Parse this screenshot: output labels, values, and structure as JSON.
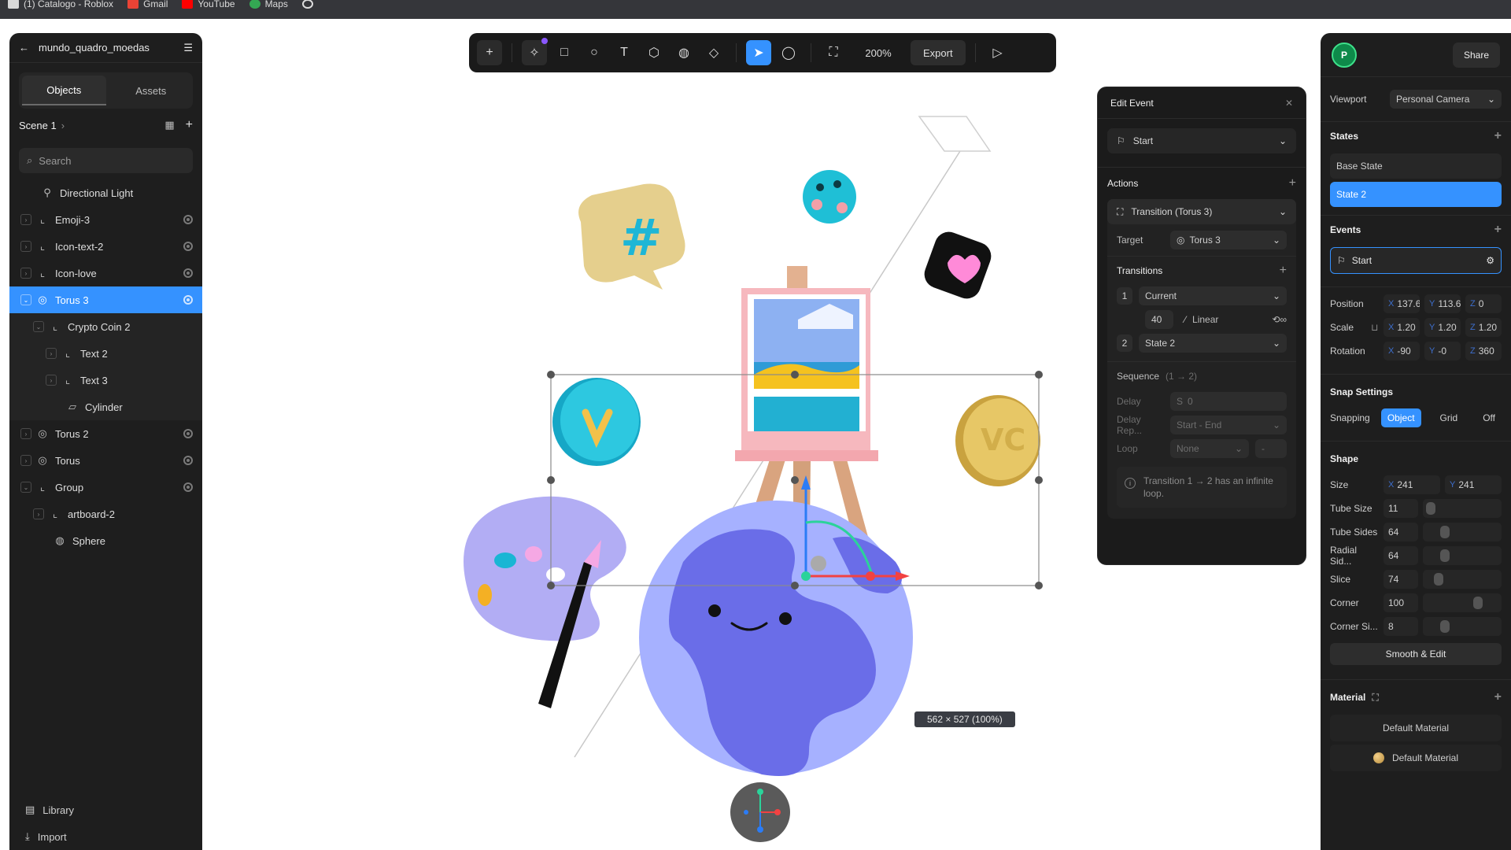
{
  "bookmarks": [
    {
      "label": "(1) Catalogo - Roblox",
      "color": "#ffffff"
    },
    {
      "label": "Gmail",
      "color": "#ea4335"
    },
    {
      "label": "YouTube",
      "color": "#ff0000"
    },
    {
      "label": "Maps",
      "color": "#34a853"
    }
  ],
  "left_panel": {
    "file_name": "mundo_quadro_moedas",
    "tabs": [
      "Objects",
      "Assets"
    ],
    "scene": "Scene 1",
    "search_placeholder": "Search",
    "tree": [
      {
        "label": "Directional Light",
        "icon": "light-icon"
      },
      {
        "label": "Emoji-3",
        "icon": "group-icon"
      },
      {
        "label": "Icon-text-2",
        "icon": "group-icon"
      },
      {
        "label": "Icon-love",
        "icon": "group-icon"
      },
      {
        "label": "Torus 3",
        "icon": "torus-icon"
      },
      {
        "label": "Crypto Coin 2",
        "icon": "group-icon"
      },
      {
        "label": "Text 2",
        "icon": "group-icon"
      },
      {
        "label": "Text 3",
        "icon": "group-icon"
      },
      {
        "label": "Cylinder",
        "icon": "cylinder-icon"
      },
      {
        "label": "Torus 2",
        "icon": "torus-icon"
      },
      {
        "label": "Torus",
        "icon": "torus-icon"
      },
      {
        "label": "Group",
        "icon": "group-icon"
      },
      {
        "label": "artboard-2",
        "icon": "group-icon"
      },
      {
        "label": "Sphere",
        "icon": "sphere-icon"
      }
    ],
    "footer": [
      "Library",
      "Import"
    ]
  },
  "toolbar": {
    "zoom": "200%",
    "export": "Export"
  },
  "canvas": {
    "dims": "562 × 527 (100%)"
  },
  "edit_event": {
    "title": "Edit Event",
    "trigger": "Start",
    "actions_label": "Actions",
    "action": "Transition (Torus 3)",
    "target_label": "Target",
    "target": "Torus 3",
    "transitions_label": "Transitions",
    "t1_index": "1",
    "t1_state": "Current",
    "t1_duration": "40",
    "t1_easing": "Linear",
    "t2_index": "2",
    "t2_state": "State 2",
    "sequence_label": "Sequence",
    "sequence_range": "(1 → 2)",
    "delay_label": "Delay",
    "delay_value": "0",
    "delay_rep_label": "Delay Rep...",
    "delay_rep_value": "Start - End",
    "loop_label": "Loop",
    "loop_value": "None",
    "info": "Transition 1 → 2 has an infinite loop."
  },
  "right_panel": {
    "avatar": "P",
    "share": "Share",
    "viewport_label": "Viewport",
    "viewport_value": "Personal Camera",
    "states_label": "States",
    "states": [
      "Base State",
      "State 2"
    ],
    "events_label": "Events",
    "event": "Start",
    "position_label": "Position",
    "position": {
      "x": "137.65",
      "y": "113.64",
      "z": "0"
    },
    "scale_label": "Scale",
    "scale": {
      "x": "1.20",
      "y": "1.20",
      "z": "1.20"
    },
    "rotation_label": "Rotation",
    "rotation": {
      "x": "-90",
      "y": "-0",
      "z": "360"
    },
    "snap_title": "Snap Settings",
    "snapping_label": "Snapping",
    "snap_options": [
      "Object",
      "Grid",
      "Off"
    ],
    "shape_title": "Shape",
    "size_label": "Size",
    "size": {
      "x": "241",
      "y": "241"
    },
    "tube_size_label": "Tube Size",
    "tube_size": "11",
    "tube_sides_label": "Tube Sides",
    "tube_sides": "64",
    "radial_label": "Radial Sid...",
    "radial": "64",
    "slice_label": "Slice",
    "slice": "74",
    "corner_label": "Corner",
    "corner": "100",
    "corner_si_label": "Corner Si...",
    "corner_si": "8",
    "smooth_edit": "Smooth & Edit",
    "material_title": "Material",
    "materials": [
      "Default Material",
      "Default Material"
    ]
  },
  "colors": {
    "accent": "#3592ff",
    "panel": "#1e1e1e",
    "globe": "#6f72f2"
  }
}
